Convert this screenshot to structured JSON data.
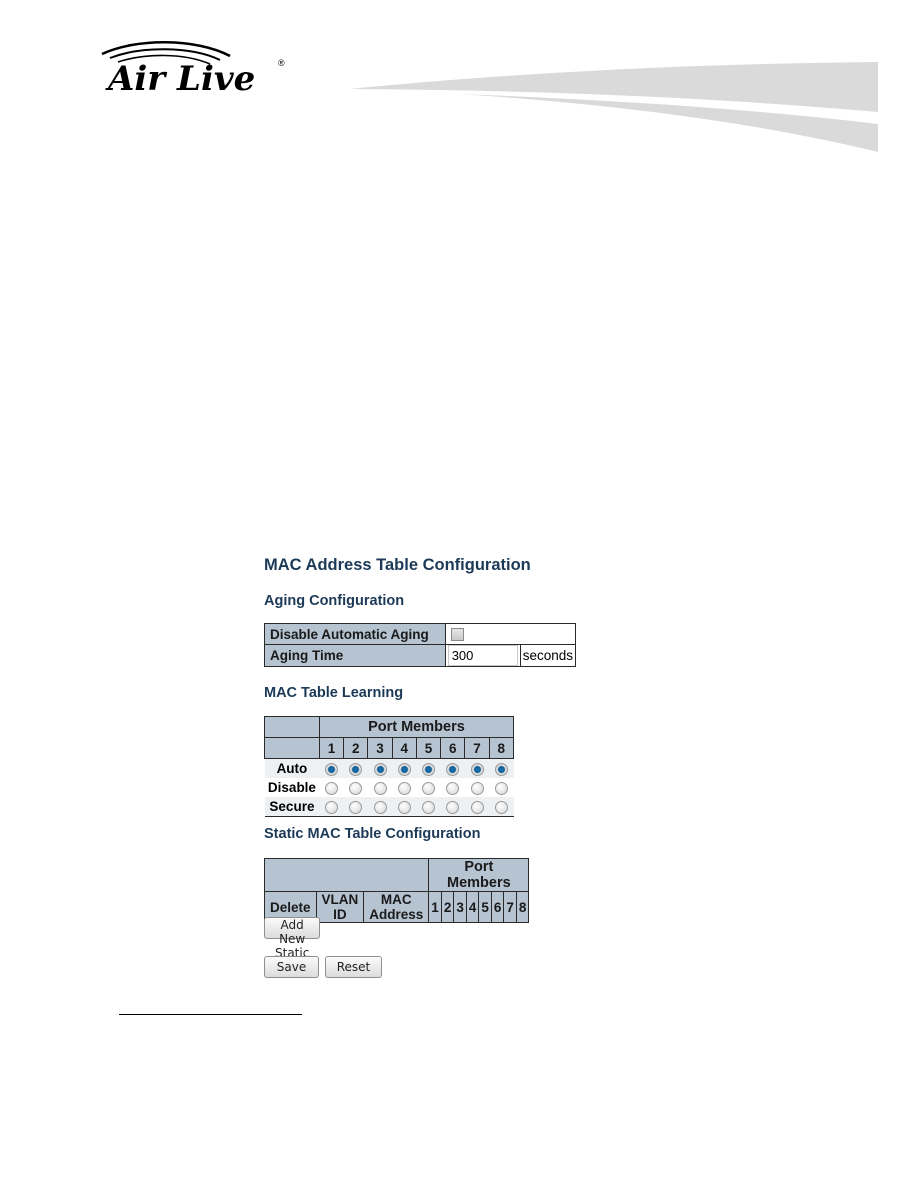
{
  "brand": {
    "name": "Air Live",
    "registered": "®"
  },
  "page": {
    "title": "MAC Address Table Configuration",
    "aging": {
      "section_title": "Aging Configuration",
      "rows": [
        {
          "label": "Disable Automatic Aging",
          "type": "checkbox",
          "checked": false
        },
        {
          "label": "Aging Time",
          "type": "number",
          "value": "300",
          "unit": "seconds"
        }
      ]
    },
    "learning": {
      "section_title": "MAC Table Learning",
      "group_header": "Port Members",
      "ports": [
        "1",
        "2",
        "3",
        "4",
        "5",
        "6",
        "7",
        "8"
      ],
      "modes": [
        "Auto",
        "Disable",
        "Secure"
      ],
      "selected_mode_per_port": [
        "Auto",
        "Auto",
        "Auto",
        "Auto",
        "Auto",
        "Auto",
        "Auto",
        "Auto"
      ]
    },
    "static": {
      "section_title": "Static MAC Table Configuration",
      "group_header": "Port Members",
      "columns": [
        "Delete",
        "VLAN ID",
        "MAC Address"
      ],
      "ports": [
        "1",
        "2",
        "3",
        "4",
        "5",
        "6",
        "7",
        "8"
      ],
      "entries": []
    },
    "buttons": {
      "add_entry": "Add New Static Entry",
      "save": "Save",
      "reset": "Reset"
    }
  }
}
